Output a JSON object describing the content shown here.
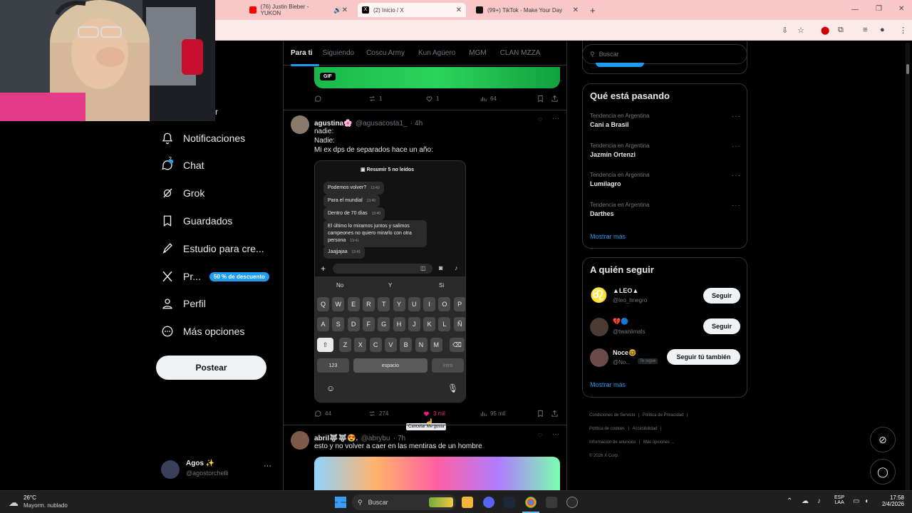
{
  "browser": {
    "tabs": [
      {
        "label": "(76) Justin Bieber - YUKON",
        "color": "#ff0000"
      },
      {
        "label": "(2) Inicio / X",
        "color": "#000000"
      },
      {
        "label": "(99+) TikTok - Make Your Day",
        "color": "#111111"
      }
    ],
    "new_tab": "+"
  },
  "sidebar": {
    "partial_label": "r",
    "items": [
      {
        "label": "Notificaciones",
        "icon": "bell-icon"
      },
      {
        "label": "Chat",
        "icon": "chat-icon",
        "badge": "2"
      },
      {
        "label": "Grok",
        "icon": "grok-icon"
      },
      {
        "label": "Guardados",
        "icon": "bookmark-icon"
      },
      {
        "label": "Estudio para cre...",
        "icon": "rocket-icon"
      },
      {
        "label": "Pr...",
        "icon": "x-logo-icon",
        "promo": "50 % de descuento"
      },
      {
        "label": "Perfil",
        "icon": "person-icon"
      },
      {
        "label": "Más opciones",
        "icon": "more-circle-icon"
      }
    ],
    "post_button": "Postear",
    "account": {
      "name": "Agos ✨",
      "handle": "@agostorchelli"
    }
  },
  "feed": {
    "tabs": [
      "Para ti",
      "Siguiendo",
      "Coscu Army",
      "Kun Agüero",
      "MGM",
      "CLAN MZZA"
    ],
    "tweet0": {
      "gif_label": "GIF",
      "reposts": "1",
      "likes": "1",
      "views": "64"
    },
    "tweet1": {
      "name": "agustina🌸",
      "handle": "@agusacosta1_",
      "time": "· 4h",
      "lines": [
        "nadie:",
        "Nadie:",
        "Mi ex dps de separados hace un año:"
      ],
      "replies": "44",
      "reposts": "274",
      "likes": "3 mil",
      "views": "95 mil",
      "tooltip": "Cancelar Me gusta"
    },
    "phone": {
      "summary": "Resumir 5 no leídos",
      "messages": [
        {
          "text": "Podemos volver?",
          "time": "13:40"
        },
        {
          "text": "Para el mundial",
          "time": "13:40"
        },
        {
          "text": "Dentro de 70 días",
          "time": "13:40"
        },
        {
          "text": "El último lo miramos juntos y salimos campeones no quiero mirarlo con otra persona",
          "time": "13:41"
        },
        {
          "text": "Jaajjajaa",
          "time": "13:41"
        }
      ],
      "suggestions": [
        "No",
        "Y",
        "Si"
      ],
      "row1": [
        "Q",
        "W",
        "E",
        "R",
        "T",
        "Y",
        "U",
        "I",
        "O",
        "P"
      ],
      "row2": [
        "A",
        "S",
        "D",
        "F",
        "G",
        "H",
        "J",
        "K",
        "L",
        "Ñ"
      ],
      "row3": [
        "Z",
        "X",
        "C",
        "V",
        "B",
        "N",
        "M"
      ],
      "num_key": "123",
      "space_key": "espacio",
      "enter_key": "intro"
    },
    "tweet2": {
      "name": "abril🐺🐺😍.",
      "handle": "@abrybu",
      "time": "· 7h",
      "text": "esto y no volver a caer en las mentiras de un hombre"
    }
  },
  "right": {
    "search_placeholder": "Buscar",
    "trends_title": "Qué está pasando",
    "trends": [
      {
        "sub": "Tendencia en Argentina",
        "name": "Cani a Brasil"
      },
      {
        "sub": "Tendencia en Argentina",
        "name": "Jazmín Ortenzi"
      },
      {
        "sub": "Tendencia en Argentina",
        "name": "Lumilagro"
      },
      {
        "sub": "Tendencia en Argentina",
        "name": "Darthes"
      }
    ],
    "show_more": "Mostrar más",
    "follow_title": "A quién seguir",
    "follow": [
      {
        "name": "▲LEO▲",
        "handle": "@leo_hnegro",
        "button": "Seguir"
      },
      {
        "name": "💔🔵",
        "handle": "@twanlimals",
        "button": "Seguir"
      },
      {
        "name": "Noce🤓",
        "handle": "@No...",
        "tag": "Te sigue",
        "button": "Seguir tú también"
      }
    ],
    "footer": [
      "Condiciones de Servicio",
      "Política de Privacidad",
      "Política de cookies",
      "Accesibilidad",
      "Información de anuncios",
      "Más opciones ...",
      "© 2026 X Corp."
    ]
  },
  "taskbar": {
    "weather_temp": "26°C",
    "weather_desc": "Mayorm. nublado",
    "search": "Buscar",
    "lang1": "ESP",
    "lang2": "LAA",
    "time": "17:58",
    "date": "2/4/2026"
  }
}
